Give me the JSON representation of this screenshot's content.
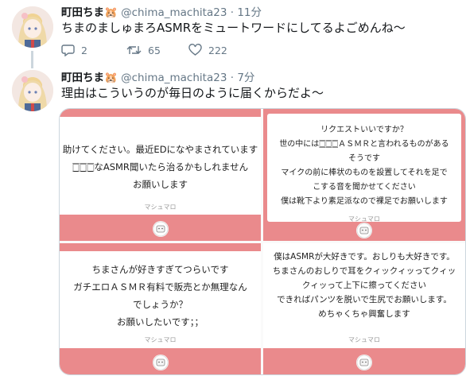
{
  "tweets": [
    {
      "name": "町田ちま",
      "emoji": "🐹",
      "handle": "@chima_machita23",
      "separator": "·",
      "time": "11分",
      "text": "ちまのましゅまろASMRをミュートワードにしてるよごめんね〜",
      "replies": "2",
      "retweets": "65",
      "likes": "222"
    },
    {
      "name": "町田ちま",
      "emoji": "🐹",
      "handle": "@chima_machita23",
      "separator": "·",
      "time": "7分",
      "text": "理由はこういうのが毎日のように届くからだよ〜"
    }
  ],
  "media_cards": [
    {
      "text": "助けてください。最近EDになやまされています\n🀆🀆🀆なASMR聞いたら治るかもしれません\nお願いします",
      "brand": "マシュマロ"
    },
    {
      "text": "リクエストいいですか？\n世の中には🀆🀆🀆ＡＳＭＲと言われるものがあるそうです\nマイクの前に棒状のものを設置してそれを足でこする音を聞かせてください\n僕は靴下より素足派なので裸足でお願いします",
      "brand": "マシュマロ"
    },
    {
      "text": "ちまさんが好きすぎてつらいです\nガチエロＡＳＭＲ有料で販売とか無理なんでしょうか？\nお願いしたいです；；",
      "brand": "マシュマロ"
    },
    {
      "text": "僕はASMRが大好きです。おしりも大好きです。\nちまさんのおしりで耳をクィックィッってクィックィッって上下に擦ってください\nできればパンツを脱いで生尻でお願いします。\nめちゃくちゃ興奮します",
      "brand": "マシュマロ"
    }
  ],
  "colors": {
    "accent": "#ea8a8c",
    "muted": "#657786",
    "thread": "#ccd6dd"
  },
  "icons": [
    "reply-icon",
    "retweet-icon",
    "like-icon",
    "marshmallow-logo-icon"
  ]
}
